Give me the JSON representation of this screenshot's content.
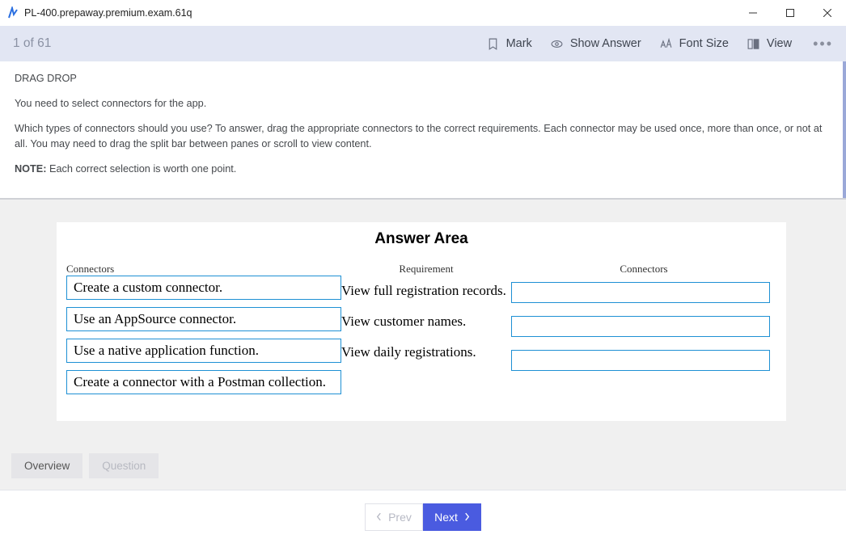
{
  "window": {
    "title": "PL-400.prepaway.premium.exam.61q"
  },
  "toolbar": {
    "counter": "1 of 61",
    "mark": "Mark",
    "show_answer": "Show Answer",
    "font_size": "Font Size",
    "view": "View"
  },
  "question": {
    "type_label": "DRAG DROP",
    "intro": "You need to select connectors for the app.",
    "instructions": "Which types of connectors should you use? To answer, drag the appropriate connectors to the correct requirements. Each connector may be used once, more than once, or not at all. You may need to drag the split bar between panes or scroll to view content.",
    "note_label": "NOTE:",
    "note_text": " Each correct selection is worth one point."
  },
  "answer_area": {
    "title": "Answer Area",
    "connectors_header": "Connectors",
    "requirement_header": "Requirement",
    "target_header": "Connectors",
    "connectors": [
      "Create a custom connector.",
      "Use an AppSource connector.",
      "Use a native application function.",
      "Create a connector with a Postman collection."
    ],
    "requirements": [
      "View full registration records.",
      "View customer names.",
      "View daily registrations."
    ]
  },
  "tabs": {
    "overview": "Overview",
    "question": "Question"
  },
  "nav": {
    "prev": "Prev",
    "next": "Next"
  }
}
